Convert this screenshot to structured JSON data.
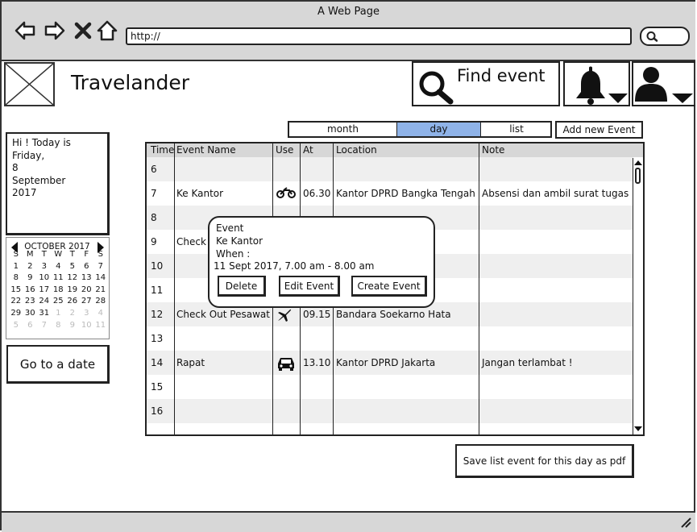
{
  "window": {
    "title": "A Web Page"
  },
  "browser": {
    "url": "http://",
    "icons": [
      "back-arrow-icon",
      "forward-arrow-icon",
      "close-icon",
      "home-icon",
      "search-icon"
    ]
  },
  "app": {
    "title": "Travelander",
    "find_label": "Find event"
  },
  "greeting": {
    "line1": "Hi ! Today is",
    "line2": "",
    "line3": "Friday,",
    "line4": "8",
    "line5": "September",
    "line6": "2017"
  },
  "calendar": {
    "month_label": "OCTOBER 2017",
    "weekdays": [
      "S",
      "M",
      "T",
      "W",
      "T",
      "F",
      "S"
    ],
    "weeks": [
      [
        "1",
        "2",
        "3",
        "4",
        "5",
        "6",
        "7"
      ],
      [
        "8",
        "9",
        "10",
        "11",
        "12",
        "13",
        "14"
      ],
      [
        "15",
        "16",
        "17",
        "18",
        "19",
        "20",
        "21"
      ],
      [
        "22",
        "23",
        "24",
        "25",
        "26",
        "27",
        "28"
      ],
      [
        "29",
        "30",
        "31",
        "1",
        "2",
        "3",
        "4"
      ],
      [
        "5",
        "6",
        "7",
        "8",
        "9",
        "10",
        "11"
      ]
    ],
    "selected_day": "16"
  },
  "goto_label": "Go to a date",
  "tabs": [
    {
      "label": "month"
    },
    {
      "label": "day"
    },
    {
      "label": "list"
    }
  ],
  "active_tab": "day",
  "add_event_label": "Add new Event",
  "table": {
    "headers": [
      "Time",
      "Event Name",
      "Use",
      "At",
      "Location",
      "Note"
    ],
    "rows": [
      {
        "time": "6",
        "name": "",
        "use": "",
        "at": "",
        "location": "",
        "note": ""
      },
      {
        "time": "7",
        "name": "Ke Kantor",
        "use": "motorcycle-icon",
        "at": "06.30",
        "location": "Kantor DPRD Bangka Tengah",
        "note": "Absensi dan ambil surat tugas"
      },
      {
        "time": "8",
        "name": "",
        "use": "",
        "at": "",
        "location": "",
        "note": ""
      },
      {
        "time": "9",
        "name": "Check",
        "use": "",
        "at": "",
        "location": "",
        "note": ""
      },
      {
        "time": "10",
        "name": "",
        "use": "",
        "at": "",
        "location": "",
        "note": ""
      },
      {
        "time": "11",
        "name": "",
        "use": "",
        "at": "",
        "location": "",
        "note": ""
      },
      {
        "time": "12",
        "name": "Check Out Pesawat",
        "use": "airplane-icon",
        "at": "09.15",
        "location": "Bandara Soekarno Hata",
        "note": ""
      },
      {
        "time": "13",
        "name": "",
        "use": "",
        "at": "",
        "location": "",
        "note": ""
      },
      {
        "time": "14",
        "name": "Rapat",
        "use": "car-icon",
        "at": "13.10",
        "location": "Kantor DPRD Jakarta",
        "note": "Jangan terlambat !"
      },
      {
        "time": "15",
        "name": "",
        "use": "",
        "at": "",
        "location": "",
        "note": ""
      },
      {
        "time": "16",
        "name": "",
        "use": "",
        "at": "",
        "location": "",
        "note": ""
      }
    ]
  },
  "popup": {
    "title": "Event",
    "event_name": "Ke Kantor",
    "when_label": "When :",
    "when_value": "11 Sept 2017, 7.00 am - 8.00 am",
    "delete_label": "Delete",
    "edit_label": "Edit Event",
    "create_label": "Create Event"
  },
  "save_pdf_label": "Save list event for this day as pdf"
}
